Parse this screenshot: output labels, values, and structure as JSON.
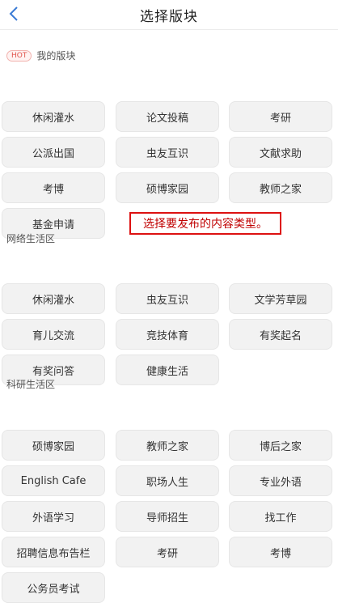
{
  "header": {
    "title": "选择版块"
  },
  "my_section": {
    "badge": "HOT",
    "title": "我的版块",
    "items": [
      "休闲灌水",
      "论文投稿",
      "考研",
      "公派出国",
      "虫友互识",
      "文献求助",
      "考博",
      "硕博家园",
      "教师之家",
      "基金申请"
    ]
  },
  "callout": {
    "text": "选择要发布的内容类型。",
    "color": "#c00000"
  },
  "net_section": {
    "title": "网络生活区",
    "items": [
      "休闲灌水",
      "虫友互识",
      "文学芳草园",
      "育儿交流",
      "竞技体育",
      "有奖起名",
      "有奖问答",
      "健康生活"
    ]
  },
  "research_section": {
    "title": "科研生活区",
    "items": [
      "硕博家园",
      "教师之家",
      "博后之家",
      "English Cafe",
      "职场人生",
      "专业外语",
      "外语学习",
      "导师招生",
      "找工作",
      "招聘信息布告栏",
      "考研",
      "考博",
      "公务员考试"
    ]
  }
}
